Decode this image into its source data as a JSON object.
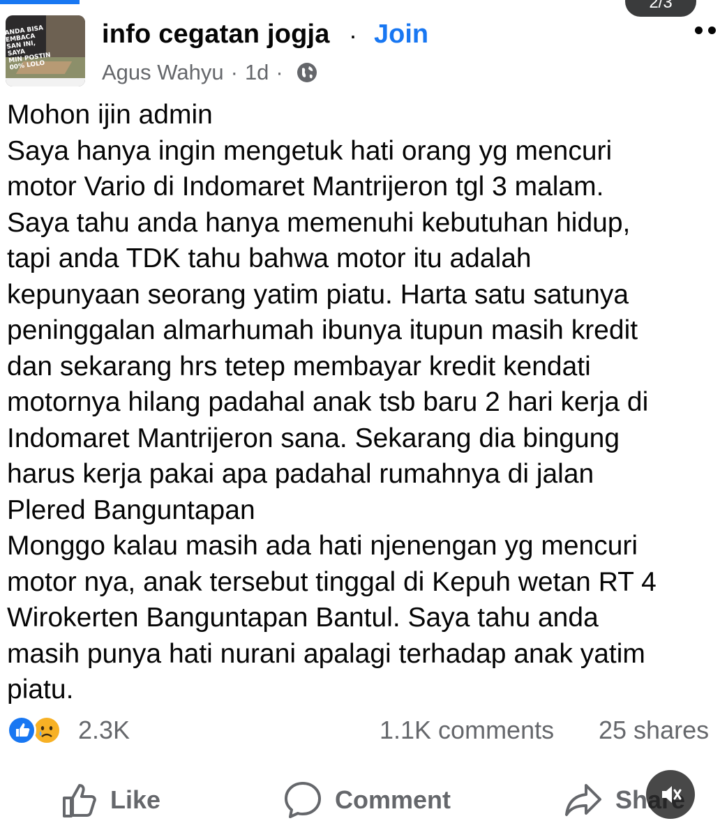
{
  "page": {
    "indicator_text": "2/3"
  },
  "post": {
    "group_name": "info cegatan jogja",
    "separator": "·",
    "join_label": "Join",
    "author": "Agus Wahyu",
    "time_ago": "1d",
    "audience_icon": "globe-icon",
    "avatar_text": "ANDA BISA\nEMBACA\nSAN INI, SAYA\nMIN POSTIN\n00% LOLO",
    "body_lines": [
      "Mohon ijin admin",
      "Saya hanya ingin mengetuk hati orang yg mencuri",
      "motor Vario di Indomaret Mantrijeron tgl 3 malam.",
      "Saya tahu anda hanya memenuhi kebutuhan hidup,",
      "tapi anda TDK tahu bahwa motor itu adalah",
      "kepunyaan seorang yatim piatu. Harta satu satunya",
      "peninggalan almarhumah ibunya itupun masih kredit",
      "dan sekarang hrs tetep membayar kredit kendati",
      "motornya hilang padahal anak tsb baru 2 hari kerja di",
      "Indomaret Mantrijeron sana. Sekarang dia bingung",
      "harus kerja pakai apa padahal rumahnya di jalan",
      "Plered Banguntapan",
      "Monggo kalau masih ada hati njenengan yg mencuri",
      "motor nya, anak tersebut tinggal di Kepuh wetan RT 4",
      "Wirokerten Banguntapan Bantul. Saya tahu anda",
      "masih punya hati nurani apalagi terhadap anak yatim",
      "piatu."
    ]
  },
  "stats": {
    "reactions": [
      "like-reaction-icon",
      "sad-reaction-icon"
    ],
    "reaction_count": "2.3K",
    "comments": "1.1K comments",
    "shares": "25 shares"
  },
  "actions": {
    "like": "Like",
    "comment": "Comment",
    "share": "Share"
  },
  "colors": {
    "accent": "#1877f2",
    "secondary_text": "#65676b",
    "primary_text": "#050505",
    "sad_reaction": "#f7b125"
  }
}
